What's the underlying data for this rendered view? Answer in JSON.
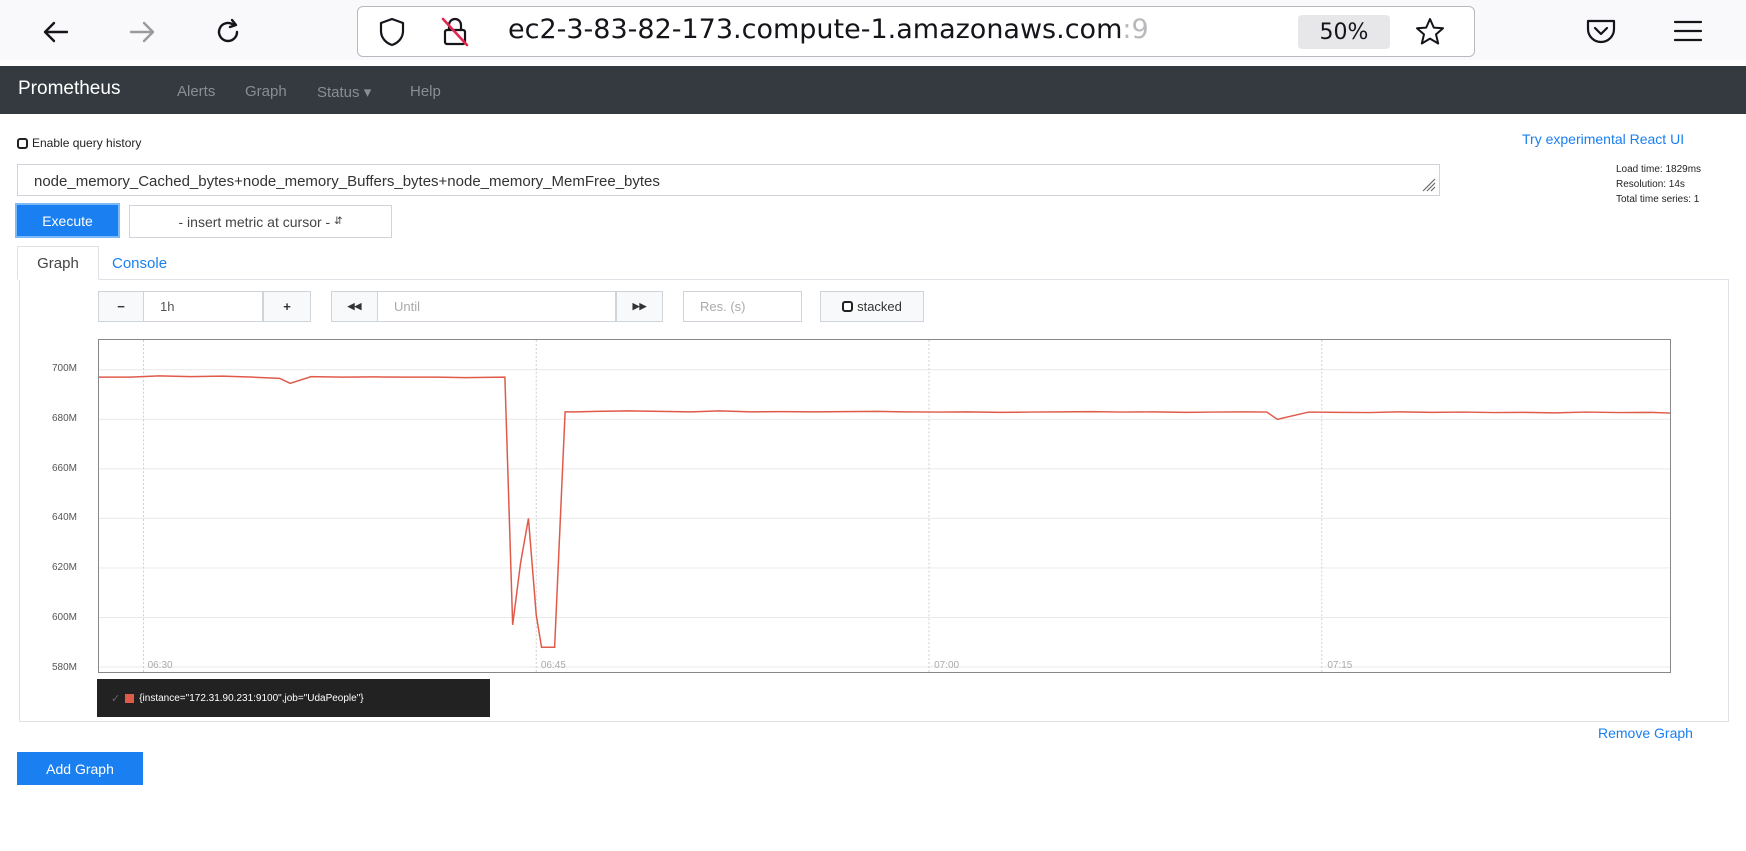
{
  "browser": {
    "url_main": "ec2-3-83-82-173.compute-1.amazonaws.com",
    "url_tail": ":9",
    "zoom": "50%",
    "icons": [
      "back-arrow-icon",
      "forward-arrow-icon",
      "reload-icon",
      "shield-icon",
      "insecure-lock-icon",
      "star-icon",
      "pocket-icon",
      "menu-icon"
    ]
  },
  "nav": {
    "brand": "Prometheus",
    "alerts": "Alerts",
    "graph": "Graph",
    "status": "Status",
    "help": "Help"
  },
  "query_history_label": "Enable query history",
  "react_link": "Try experimental React UI",
  "stats": {
    "load_time": "Load time: 1829ms",
    "resolution": "Resolution: 14s",
    "total_series": "Total time series: 1"
  },
  "expression": "node_memory_Cached_bytes+node_memory_Buffers_bytes+node_memory_MemFree_bytes",
  "execute_label": "Execute",
  "metric_select": "- insert metric at cursor -",
  "tabs": {
    "graph": "Graph",
    "console": "Console"
  },
  "controls": {
    "minus": "−",
    "range": "1h",
    "plus": "+",
    "back": "◀◀",
    "until_placeholder": "Until",
    "forward": "▶▶",
    "res_placeholder": "Res. (s)",
    "stacked": "stacked"
  },
  "legend_label": "{instance=\"172.31.90.231:9100\",job=\"UdaPeople\"}",
  "remove_graph": "Remove Graph",
  "add_graph": "Add Graph",
  "chart_data": {
    "type": "line",
    "x_ticks": [
      "06:30",
      "06:45",
      "07:00",
      "07:15"
    ],
    "y_ticks": [
      "700M",
      "680M",
      "660M",
      "640M",
      "620M",
      "600M",
      "580M"
    ],
    "ylim": [
      578,
      712
    ],
    "x_range_minutes": [
      28.3,
      88.3
    ],
    "grid": true,
    "series": [
      {
        "name": "{instance=\"172.31.90.231:9100\",job=\"UdaPeople\"}",
        "color": "#e05a4a",
        "x": [
          28.3,
          29.5,
          30.6,
          31.8,
          33.0,
          34.2,
          35.2,
          35.6,
          36.4,
          37.6,
          38.8,
          40.0,
          41.2,
          42.3,
          43.8,
          44.1,
          44.4,
          44.7,
          45.0,
          45.2,
          45.7,
          46.1,
          46.5,
          47.3,
          48.5,
          49.7,
          50.9,
          52.0,
          53.2,
          54.4,
          55.6,
          56.8,
          58.0,
          59.1,
          60.3,
          61.5,
          62.7,
          63.9,
          65.0,
          66.2,
          67.4,
          68.6,
          69.8,
          70.9,
          72.1,
          72.9,
          73.3,
          74.5,
          75.7,
          76.8,
          78.0,
          79.2,
          80.4,
          81.6,
          82.7,
          83.9,
          85.1,
          86.3,
          87.5,
          88.3
        ],
        "y": [
          697.0,
          697.0,
          697.5,
          697.2,
          697.4,
          697.0,
          696.5,
          694.5,
          697.2,
          697.0,
          697.1,
          697.0,
          697.0,
          696.8,
          697.0,
          597.0,
          622.0,
          640.0,
          601.0,
          588.0,
          588.0,
          683.0,
          683.0,
          683.2,
          683.4,
          683.2,
          683.0,
          683.4,
          683.0,
          683.1,
          683.0,
          683.1,
          683.2,
          683.0,
          682.9,
          683.0,
          682.8,
          682.9,
          683.0,
          683.1,
          682.9,
          683.0,
          682.8,
          682.9,
          683.0,
          682.9,
          680.0,
          682.9,
          682.8,
          682.7,
          683.0,
          682.8,
          682.9,
          682.7,
          682.8,
          682.6,
          682.9,
          682.7,
          682.8,
          682.5
        ]
      }
    ]
  }
}
